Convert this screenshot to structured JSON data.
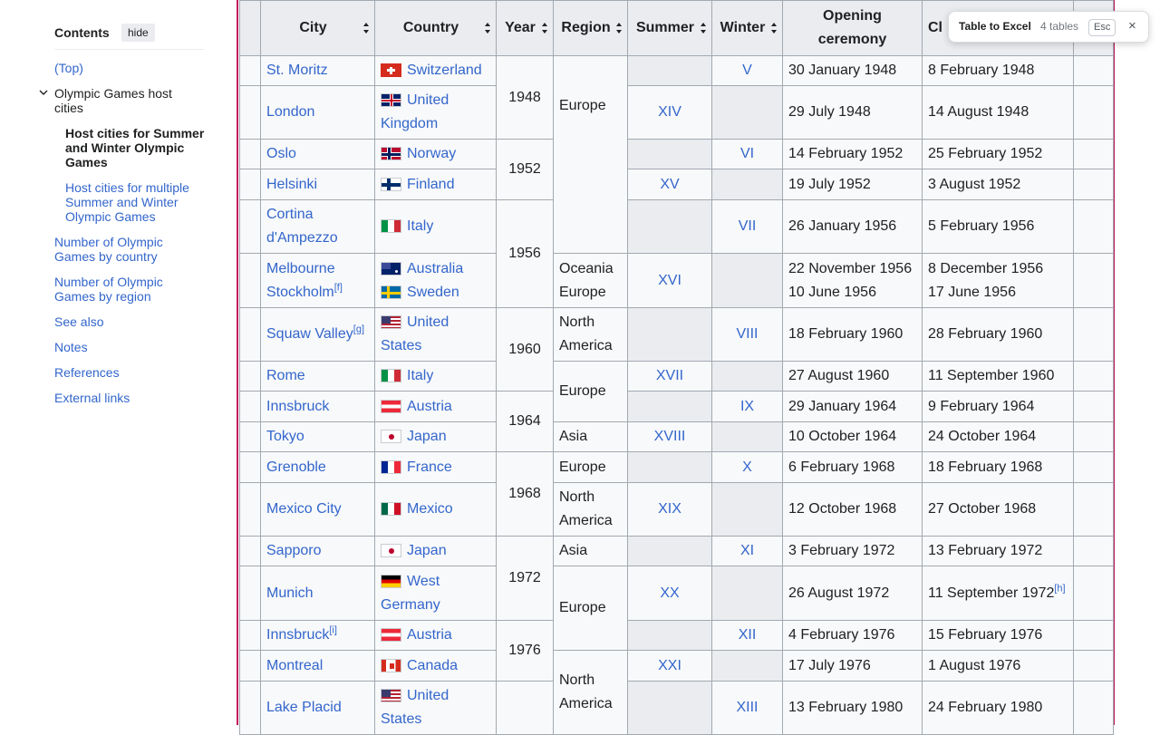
{
  "toc": {
    "title": "Contents",
    "hide": "hide",
    "items": [
      {
        "label": "(Top)"
      },
      {
        "label": "Olympic Games host cities"
      },
      {
        "label": "Host cities for Summer and Winter Olympic Games"
      },
      {
        "label": "Host cities for multiple Summer and Winter Olympic Games"
      },
      {
        "label": "Number of Olympic Games by country"
      },
      {
        "label": "Number of Olympic Games by region"
      },
      {
        "label": "See also"
      },
      {
        "label": "Notes"
      },
      {
        "label": "References"
      },
      {
        "label": "External links"
      }
    ]
  },
  "table": {
    "headers": {
      "city": "City",
      "country": "Country",
      "year": "Year",
      "region": "Region",
      "summer": "Summer",
      "winter": "Winter",
      "opening": "Opening ceremony",
      "closing": "Cl"
    },
    "rows": [
      {
        "city": "St. Moritz",
        "country": "Switzerland",
        "year": "1948",
        "region": "Europe",
        "winter": "V",
        "opening": "30 January 1948",
        "closing": "8 February 1948"
      },
      {
        "city": "London",
        "country": "United Kingdom",
        "summer": "XIV",
        "opening": "29 July 1948",
        "closing": "14 August 1948"
      },
      {
        "city": "Oslo",
        "country": "Norway",
        "year": "1952",
        "winter": "VI",
        "opening": "14 February 1952",
        "closing": "25 February 1952"
      },
      {
        "city": "Helsinki",
        "country": "Finland",
        "summer": "XV",
        "opening": "19 July 1952",
        "closing": "3 August 1952"
      },
      {
        "city": "Cortina d'Ampezzo",
        "country": "Italy",
        "year": "1956",
        "winter": "VII",
        "opening": "26 January 1956",
        "closing": "5 February 1956"
      },
      {
        "city1": "Melbourne",
        "city2": "Stockholm",
        "city2_note": "[f]",
        "country1": "Australia",
        "country2": "Sweden",
        "region1": "Oceania",
        "region2": "Europe",
        "summer": "XVI",
        "opening1": "22 November 1956",
        "opening2": "10 June 1956",
        "closing1": "8 December 1956",
        "closing2": "17 June 1956"
      },
      {
        "city": "Squaw Valley",
        "city_note": "[g]",
        "country": "United States",
        "year": "1960",
        "region": "North America",
        "winter": "VIII",
        "opening": "18 February 1960",
        "closing": "28 February 1960"
      },
      {
        "city": "Rome",
        "country": "Italy",
        "region": "Europe",
        "summer": "XVII",
        "opening": "27 August 1960",
        "closing": "11 September 1960"
      },
      {
        "city": "Innsbruck",
        "country": "Austria",
        "year": "1964",
        "winter": "IX",
        "opening": "29 January 1964",
        "closing": "9 February 1964"
      },
      {
        "city": "Tokyo",
        "country": "Japan",
        "region": "Asia",
        "summer": "XVIII",
        "opening": "10 October 1964",
        "closing": "24 October 1964"
      },
      {
        "city": "Grenoble",
        "country": "France",
        "year": "1968",
        "region": "Europe",
        "winter": "X",
        "opening": "6 February 1968",
        "closing": "18 February 1968"
      },
      {
        "city": "Mexico City",
        "country": "Mexico",
        "region": "North America",
        "summer": "XIX",
        "opening": "12 October 1968",
        "closing": "27 October 1968"
      },
      {
        "city": "Sapporo",
        "country": "Japan",
        "year": "1972",
        "region": "Asia",
        "winter": "XI",
        "opening": "3 February 1972",
        "closing": "13 February 1972"
      },
      {
        "city": "Munich",
        "country": "West Germany",
        "region": "Europe",
        "summer": "XX",
        "opening": "26 August 1972",
        "closing": "11 September 1972",
        "closing_note": "[h]"
      },
      {
        "city": "Innsbruck",
        "city_note": "[i]",
        "country": "Austria",
        "year": "1976",
        "winter": "XII",
        "opening": "4 February 1976",
        "closing": "15 February 1976"
      },
      {
        "city": "Montreal",
        "country": "Canada",
        "region": "North America",
        "summer": "XXI",
        "opening": "17 July 1976",
        "closing": "1 August 1976"
      },
      {
        "city": "Lake Placid",
        "country": "United States",
        "winter": "XIII",
        "opening": "13 February 1980",
        "closing": "24 February 1980"
      }
    ]
  },
  "popup": {
    "title": "Table to Excel",
    "count": "4 tables",
    "esc": "Esc",
    "close": "×"
  },
  "colors": {
    "link": "#3366cc",
    "header_bg": "#eaecf0",
    "cell_bg": "#f8f9fa",
    "border": "#a2a9b1",
    "highlight": "#c2185b"
  }
}
